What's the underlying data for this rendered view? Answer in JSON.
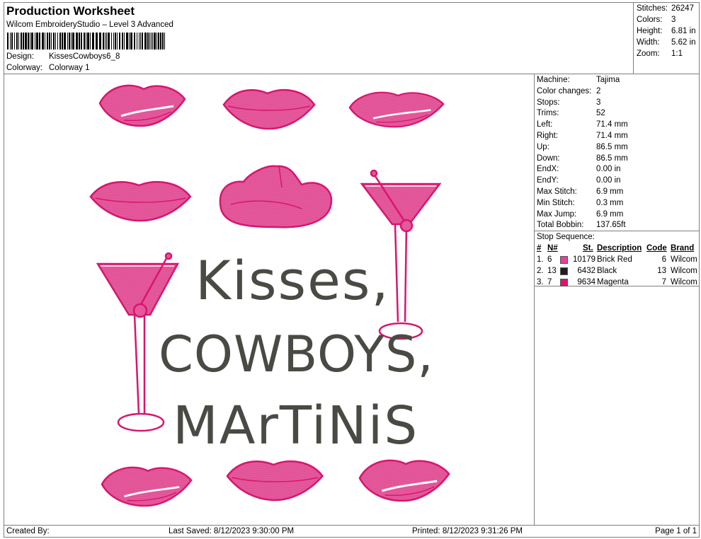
{
  "header": {
    "title": "Production Worksheet",
    "subtitle": "Wilcom EmbroideryStudio – Level 3 Advanced",
    "design_label": "Design:",
    "design_value": "KissesCowboys6_8",
    "colorway_label": "Colorway:",
    "colorway_value": "Colorway 1"
  },
  "summary": [
    {
      "label": "Stitches:",
      "value": "26247"
    },
    {
      "label": "Colors:",
      "value": "3"
    },
    {
      "label": "Height:",
      "value": "6.81 in"
    },
    {
      "label": "Width:",
      "value": "5.62 in"
    },
    {
      "label": "Zoom:",
      "value": "1:1"
    }
  ],
  "machine": [
    {
      "label": "Machine:",
      "value": "Tajima"
    },
    {
      "label": "Color changes:",
      "value": "2"
    },
    {
      "label": "Stops:",
      "value": "3"
    },
    {
      "label": "Trims:",
      "value": "52"
    },
    {
      "label": "Left:",
      "value": "71.4 mm"
    },
    {
      "label": "Right:",
      "value": "71.4 mm"
    },
    {
      "label": "Up:",
      "value": "86.5 mm"
    },
    {
      "label": "Down:",
      "value": "86.5 mm"
    },
    {
      "label": "EndX:",
      "value": "0.00 in"
    },
    {
      "label": "EndY:",
      "value": "0.00 in"
    },
    {
      "label": "Max Stitch:",
      "value": "6.9 mm"
    },
    {
      "label": "Min Stitch:",
      "value": "0.3 mm"
    },
    {
      "label": "Max Jump:",
      "value": "6.9 mm"
    },
    {
      "label": "Total Bobbin:",
      "value": "137.65ft"
    }
  ],
  "stop_sequence": {
    "title": "Stop Sequence:",
    "headers": {
      "num": "#",
      "needle": "N#",
      "st": "St.",
      "description": "Description",
      "code": "Code",
      "brand": "Brand"
    },
    "rows": [
      {
        "num": "1.",
        "needle": "6",
        "color": "#e8409a",
        "st": "10179",
        "description": "Brick Red",
        "code": "6",
        "brand": "Wilcom"
      },
      {
        "num": "2.",
        "needle": "13",
        "color": "#1e1e1e",
        "st": "6432",
        "description": "Black",
        "code": "13",
        "brand": "Wilcom"
      },
      {
        "num": "3.",
        "needle": "7",
        "color": "#d8156e",
        "st": "9634",
        "description": "Magenta",
        "code": "7",
        "brand": "Wilcom"
      }
    ]
  },
  "design_text": {
    "line1": "Kisses,",
    "line2": "COWBOYS,",
    "line3": "MArTiNiS"
  },
  "colors": {
    "lip_fill": "#e5589b",
    "lip_outline": "#d8156e",
    "text": "#4a4a45"
  },
  "footer": {
    "created_by": "Created By:",
    "last_saved": "Last Saved: 8/12/2023 9:30:00 PM",
    "printed": "Printed: 8/12/2023 9:31:26 PM",
    "page": "Page 1 of 1"
  }
}
